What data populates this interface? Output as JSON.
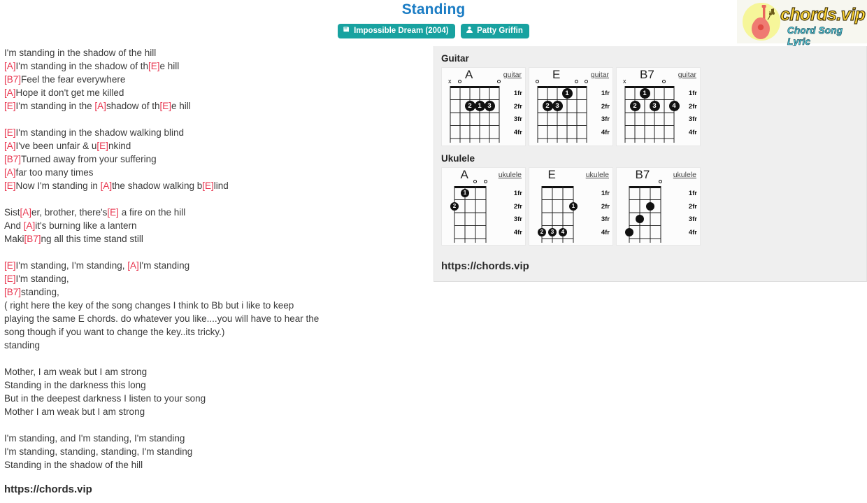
{
  "header": {
    "title": "Standing",
    "badges": [
      {
        "icon": "book-icon",
        "label": "Impossible Dream (2004)"
      },
      {
        "icon": "person-icon",
        "label": "Patty Griffin"
      }
    ]
  },
  "logo": {
    "wordmark": "chords.vip",
    "tagline": "Chord Song Lyric",
    "icon": "guitar-icon"
  },
  "colors": {
    "title_blue": "#1a7cc4",
    "badge_teal": "#18a2a0",
    "chord_red": "#e8344e",
    "panel_gray": "#efefef",
    "logo_yellow": "#f6f69a",
    "logo_text": "#ffd633",
    "logo_tagline": "#55d6e8"
  },
  "lyrics": {
    "lines": [
      [
        {
          "t": "text",
          "v": "I'm standing in the shadow of the hill"
        }
      ],
      [
        {
          "t": "chord",
          "v": "[A]"
        },
        {
          "t": "text",
          "v": "I'm standing in the shadow of th"
        },
        {
          "t": "chord",
          "v": "[E]"
        },
        {
          "t": "text",
          "v": "e hill"
        }
      ],
      [
        {
          "t": "chord",
          "v": "[B7]"
        },
        {
          "t": "text",
          "v": "Feel the fear everywhere"
        }
      ],
      [
        {
          "t": "chord",
          "v": "[A]"
        },
        {
          "t": "text",
          "v": "Hope it don't get me killed"
        }
      ],
      [
        {
          "t": "chord",
          "v": "[E]"
        },
        {
          "t": "text",
          "v": "I'm standing in the "
        },
        {
          "t": "chord",
          "v": "[A]"
        },
        {
          "t": "text",
          "v": "shadow of th"
        },
        {
          "t": "chord",
          "v": "[E]"
        },
        {
          "t": "text",
          "v": "e hill"
        }
      ],
      [
        {
          "t": "blank",
          "v": ""
        }
      ],
      [
        {
          "t": "chord",
          "v": "[E]"
        },
        {
          "t": "text",
          "v": "I'm standing in the shadow walking blind"
        }
      ],
      [
        {
          "t": "chord",
          "v": "[A]"
        },
        {
          "t": "text",
          "v": "I've been unfair & u"
        },
        {
          "t": "chord",
          "v": "[E]"
        },
        {
          "t": "text",
          "v": "nkind"
        }
      ],
      [
        {
          "t": "chord",
          "v": "[B7]"
        },
        {
          "t": "text",
          "v": "Turned away from your suffering"
        }
      ],
      [
        {
          "t": "chord",
          "v": "[A]"
        },
        {
          "t": "text",
          "v": "far too many times"
        }
      ],
      [
        {
          "t": "chord",
          "v": "[E]"
        },
        {
          "t": "text",
          "v": "Now I'm standing in "
        },
        {
          "t": "chord",
          "v": "[A]"
        },
        {
          "t": "text",
          "v": "the shadow walking b"
        },
        {
          "t": "chord",
          "v": "[E]"
        },
        {
          "t": "text",
          "v": "lind"
        }
      ],
      [
        {
          "t": "blank",
          "v": ""
        }
      ],
      [
        {
          "t": "text",
          "v": "Sist"
        },
        {
          "t": "chord",
          "v": "[A]"
        },
        {
          "t": "text",
          "v": "er, brother, there's"
        },
        {
          "t": "chord",
          "v": "[E]"
        },
        {
          "t": "text",
          "v": " a fire on the hill"
        }
      ],
      [
        {
          "t": "text",
          "v": "And "
        },
        {
          "t": "chord",
          "v": "[A]"
        },
        {
          "t": "text",
          "v": "it's burning like a lantern"
        }
      ],
      [
        {
          "t": "text",
          "v": "Maki"
        },
        {
          "t": "chord",
          "v": "[B7]"
        },
        {
          "t": "text",
          "v": "ng all this time stand still"
        }
      ],
      [
        {
          "t": "blank",
          "v": ""
        }
      ],
      [
        {
          "t": "chord",
          "v": "[E]"
        },
        {
          "t": "text",
          "v": "I'm standing, I'm standing, "
        },
        {
          "t": "chord",
          "v": "[A]"
        },
        {
          "t": "text",
          "v": "I'm standing"
        }
      ],
      [
        {
          "t": "chord",
          "v": "[E]"
        },
        {
          "t": "text",
          "v": "I'm standing,"
        }
      ],
      [
        {
          "t": "chord",
          "v": "[B7]"
        },
        {
          "t": "text",
          "v": "standing,"
        }
      ],
      [
        {
          "t": "text",
          "v": "( right here the key of the song changes I think to Bb but i like to keep"
        }
      ],
      [
        {
          "t": "text",
          "v": "playing the same E chords. do whatever you like....you will have to hear the"
        }
      ],
      [
        {
          "t": "text",
          "v": "song though if you want to change the key..its tricky.)"
        }
      ],
      [
        {
          "t": "text",
          "v": "standing"
        }
      ],
      [
        {
          "t": "blank",
          "v": ""
        }
      ],
      [
        {
          "t": "text",
          "v": "Mother, I am weak but I am strong"
        }
      ],
      [
        {
          "t": "text",
          "v": "Standing in the darkness this long"
        }
      ],
      [
        {
          "t": "text",
          "v": "But in the deepest darkness I listen to your song"
        }
      ],
      [
        {
          "t": "text",
          "v": "Mother I am weak but I am strong"
        }
      ],
      [
        {
          "t": "blank",
          "v": ""
        }
      ],
      [
        {
          "t": "text",
          "v": "I'm standing, and I'm standing, I'm standing"
        }
      ],
      [
        {
          "t": "text",
          "v": "I'm standing, standing, standing, I'm standing"
        }
      ],
      [
        {
          "t": "text",
          "v": "Standing in the shadow of the hill"
        }
      ]
    ],
    "bottom_url": "https://chords.vip"
  },
  "chord_panel": {
    "guitar_label": "Guitar",
    "ukulele_label": "Ukulele",
    "panel_url": "https://chords.vip",
    "fret_labels": [
      "1fr",
      "2fr",
      "3fr",
      "4fr"
    ],
    "guitar": {
      "instrument_tag": "guitar",
      "chords": [
        {
          "name": "A",
          "open_strings": [
            2,
            6
          ],
          "muted_strings": [
            1
          ],
          "dots": [
            {
              "string": 3,
              "fret": 2,
              "finger": "2"
            },
            {
              "string": 4,
              "fret": 2,
              "finger": "1"
            },
            {
              "string": 5,
              "fret": 2,
              "finger": "3"
            }
          ]
        },
        {
          "name": "E",
          "open_strings": [
            1,
            5,
            6
          ],
          "muted_strings": [],
          "dots": [
            {
              "string": 4,
              "fret": 1,
              "finger": "1"
            },
            {
              "string": 2,
              "fret": 2,
              "finger": "2"
            },
            {
              "string": 3,
              "fret": 2,
              "finger": "3"
            }
          ]
        },
        {
          "name": "B7",
          "open_strings": [
            5
          ],
          "muted_strings": [
            1
          ],
          "dots": [
            {
              "string": 3,
              "fret": 1,
              "finger": "1"
            },
            {
              "string": 2,
              "fret": 2,
              "finger": "2"
            },
            {
              "string": 4,
              "fret": 2,
              "finger": "3"
            },
            {
              "string": 6,
              "fret": 2,
              "finger": "4"
            }
          ]
        }
      ]
    },
    "ukulele": {
      "instrument_tag": "ukulele",
      "chords": [
        {
          "name": "A",
          "open_strings": [
            3,
            4
          ],
          "muted_strings": [],
          "dots": [
            {
              "string": 2,
              "fret": 1,
              "finger": "1"
            },
            {
              "string": 1,
              "fret": 2,
              "finger": "2"
            }
          ]
        },
        {
          "name": "E",
          "open_strings": [],
          "muted_strings": [],
          "dots": [
            {
              "string": 4,
              "fret": 2,
              "finger": "1"
            },
            {
              "string": 1,
              "fret": 4,
              "finger": "2"
            },
            {
              "string": 2,
              "fret": 4,
              "finger": "3"
            },
            {
              "string": 3,
              "fret": 4,
              "finger": "4"
            }
          ]
        },
        {
          "name": "B7",
          "open_strings": [
            4
          ],
          "muted_strings": [],
          "dots": [
            {
              "string": 3,
              "fret": 2,
              "finger": ""
            },
            {
              "string": 2,
              "fret": 3,
              "finger": ""
            },
            {
              "string": 1,
              "fret": 4,
              "finger": ""
            }
          ]
        }
      ]
    }
  }
}
